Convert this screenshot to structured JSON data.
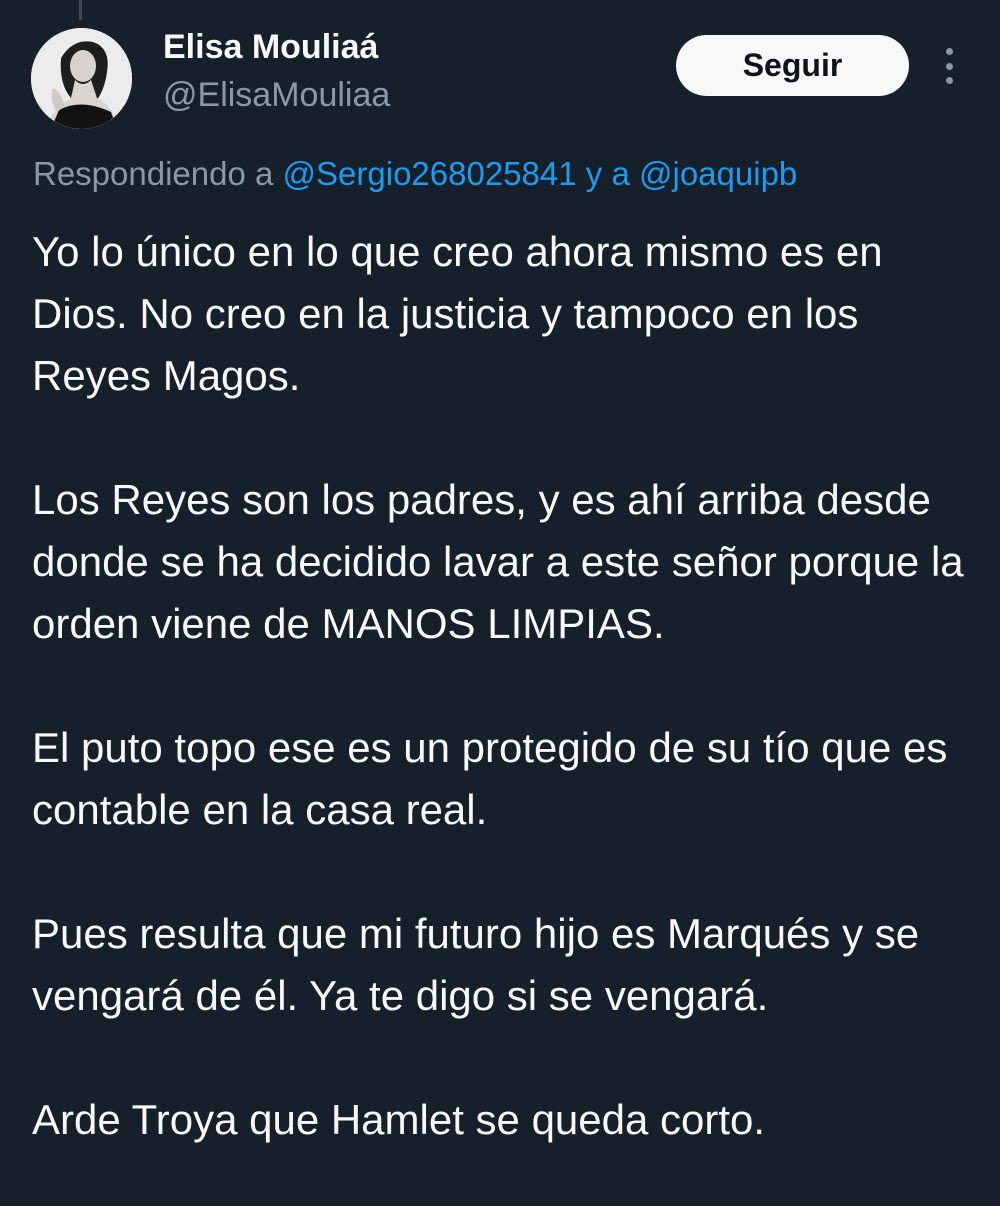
{
  "tweet": {
    "author": {
      "display_name": "Elisa Mouliaá",
      "handle": "@ElisaMouliaa"
    },
    "follow_label": "Seguir",
    "more_icon": "more-vertical-icon",
    "replying": {
      "prefix": "Respondiendo a",
      "mention_1": "@Sergio268025841",
      "connector": "y a",
      "mention_2": "@joaquipb"
    },
    "paragraphs": [
      "Yo lo único en lo que creo ahora mismo es en Dios. No creo en la justicia y tampoco en los Reyes Magos.",
      "Los Reyes son los padres, y es ahí arriba desde donde se ha decidido lavar a este señor porque la orden viene de MANOS LIMPIAS.",
      "El puto topo ese es un protegido de su tío que es contable en la casa real.",
      "Pues resulta que mi futuro hijo es Marqués y se vengará de él. Ya te digo si se vengará.",
      "Arde Troya que Hamlet se queda corto."
    ]
  },
  "colors": {
    "background": "#15202b",
    "text_primary": "#f7f9f9",
    "text_secondary": "#8b98a5",
    "link": "#1d9bf0",
    "button_bg": "#f7f9f9",
    "button_text": "#0f1419"
  }
}
